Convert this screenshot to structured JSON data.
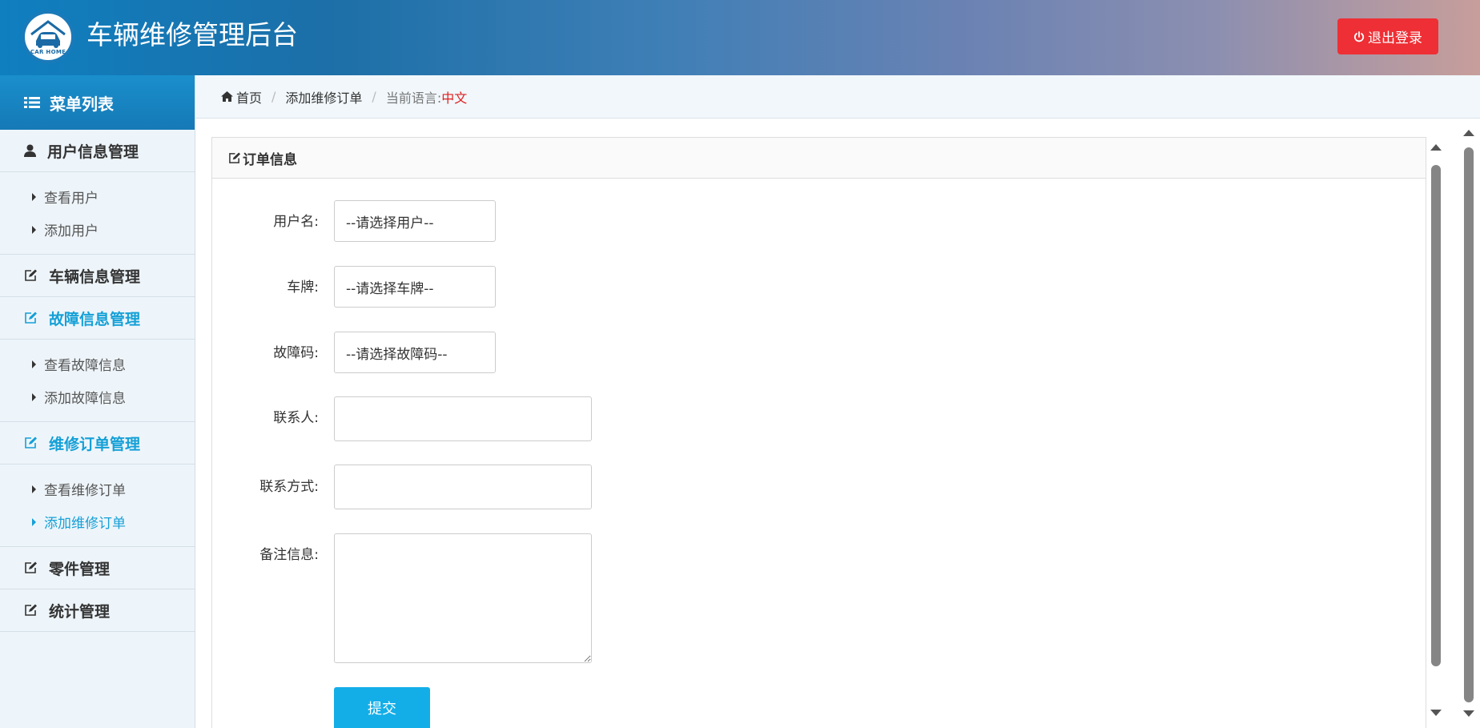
{
  "header": {
    "logo_text": "CAR HOME",
    "title": "车辆维修管理后台",
    "logout_label": "退出登录"
  },
  "sidebar": {
    "heading": "菜单列表",
    "groups": [
      {
        "label": "用户信息管理",
        "icon": "user-icon",
        "items": [
          "查看用户",
          "添加用户"
        ]
      },
      {
        "label": "车辆信息管理",
        "icon": "edit-icon"
      },
      {
        "label": "故障信息管理",
        "icon": "edit-icon",
        "items": [
          "查看故障信息",
          "添加故障信息"
        ]
      },
      {
        "label": "维修订单管理",
        "icon": "edit-icon",
        "items": [
          "查看维修订单",
          "添加维修订单"
        ]
      },
      {
        "label": "零件管理",
        "icon": "edit-icon"
      },
      {
        "label": "统计管理",
        "icon": "edit-icon"
      }
    ],
    "active_item": "添加维修订单"
  },
  "breadcrumb": {
    "home": "首页",
    "current": "添加维修订单",
    "lang_label": "当前语言:",
    "lang_value": "中文"
  },
  "panel": {
    "title": "订单信息"
  },
  "form": {
    "user_label": "用户名:",
    "user_placeholder": "--请选择用户--",
    "plate_label": "车牌:",
    "plate_placeholder": "--请选择车牌--",
    "fault_label": "故障码:",
    "fault_placeholder": "--请选择故障码--",
    "contact_label": "联系人:",
    "contact_value": "",
    "phone_label": "联系方式:",
    "phone_value": "",
    "remark_label": "备注信息:",
    "remark_value": "",
    "submit_label": "提交"
  },
  "colors": {
    "accent": "#15a0d7",
    "logout": "#ee2f35",
    "submit": "#13aee8",
    "lang": "#e02020"
  }
}
